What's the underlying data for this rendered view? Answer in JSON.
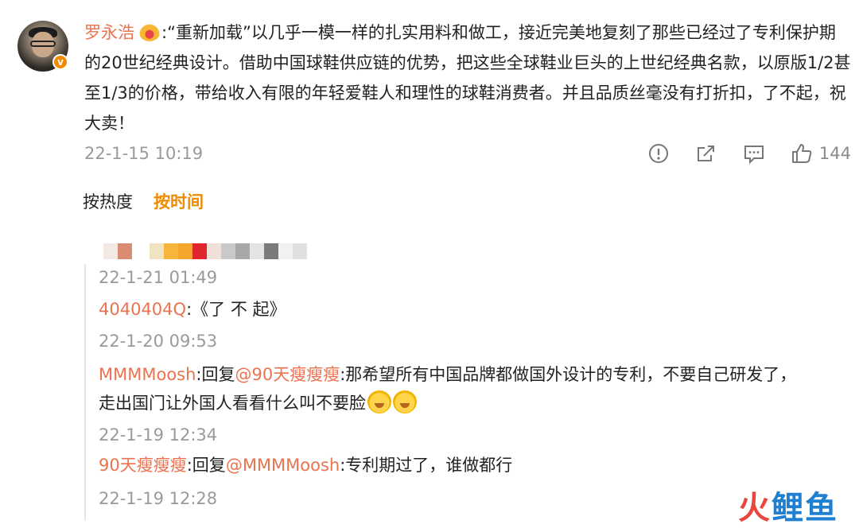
{
  "post": {
    "author": "罗永浩",
    "body": ":“重新加载”以几乎一模一样的扎实用料和做工，接近完美地复刻了那些已经过了专利保护期的20世纪经典设计。借助中国球鞋供应链的优势，把这些全球鞋业巨头的上世纪经典名款，以原版1/2甚至1/3的价格，带给收入有限的年轻爱鞋人和理性的球鞋消费者。并且品质丝毫没有打折扣，了不起，祝大卖！",
    "timestamp": "22-1-15 10:19",
    "like_count": "144",
    "verified_badge": "v",
    "icons": [
      "report-icon",
      "share-icon",
      "comment-icon",
      "like-icon"
    ]
  },
  "sort": {
    "hot": "按热度",
    "time": "按时间"
  },
  "comments": [
    {
      "time": "22-1-21 01:49"
    },
    {
      "user": "4040404Q",
      "text": ":《了 不 起》",
      "time": "22-1-20 09:53"
    },
    {
      "user": "MMMMoosh",
      "reply_prefix": ":回复",
      "mention": "@90天瘦瘦瘦",
      "text1": ":那希望所有中国品牌都做国外设计的专利，不要自己研发了，",
      "text2": "走出国门让外国人看看什么叫不要脸",
      "time": "22-1-19 12:34"
    },
    {
      "user": "90天瘦瘦瘦",
      "reply_prefix": ":回复",
      "mention": "@MMMMoosh",
      "text": ":专利期过了，谁做都行",
      "time": "22-1-19 12:28"
    }
  ],
  "watermark": {
    "part1": "火",
    "part2": "鲤鱼"
  },
  "colors": {
    "username": "#eb7350",
    "accent": "#f08a00",
    "muted": "#9a9a9a"
  }
}
